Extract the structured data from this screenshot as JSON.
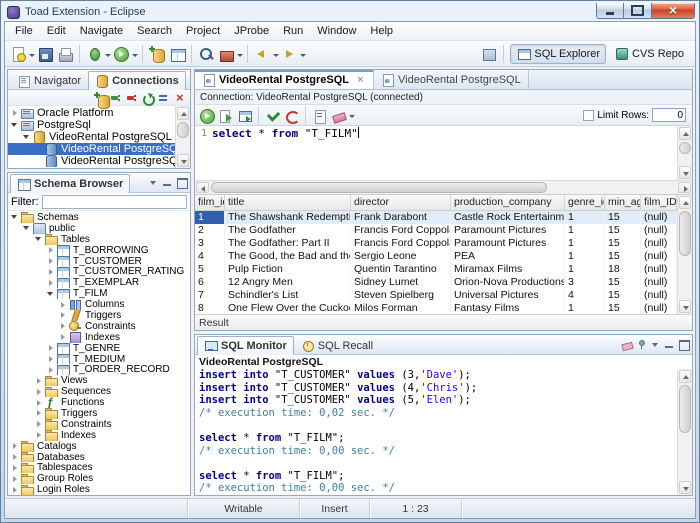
{
  "titlebar": {
    "title": "Toad Extension - Eclipse"
  },
  "menubar": {
    "items": [
      "File",
      "Edit",
      "Navigate",
      "Search",
      "Project",
      "JProbe",
      "Run",
      "Window",
      "Help"
    ]
  },
  "toolbar": {
    "items": [
      {
        "icon": "new-wizard",
        "caret": true
      },
      {
        "icon": "save"
      },
      {
        "icon": "print"
      },
      {
        "sep": true
      },
      {
        "icon": "debug",
        "caret": true
      },
      {
        "icon": "run",
        "caret": true
      },
      {
        "sep": true
      },
      {
        "icon": "new-connection"
      },
      {
        "icon": "sql-editor"
      },
      {
        "sep": true
      },
      {
        "icon": "search"
      },
      {
        "icon": "external-tools",
        "caret": true
      },
      {
        "sep": true
      },
      {
        "icon": "back",
        "caret": true
      },
      {
        "icon": "forward",
        "caret": true
      }
    ],
    "perspectives": [
      {
        "label": "SQL Explorer",
        "icon": "sql-explorer",
        "active": true
      },
      {
        "label": "CVS Repo",
        "icon": "cvs-repo",
        "active": false
      }
    ]
  },
  "connections_panel": {
    "tabs": [
      {
        "label": "Navigator",
        "icon": "navigator",
        "active": false
      },
      {
        "label": "Connections",
        "icon": "connections",
        "active": true
      }
    ],
    "corner": [
      {
        "icon": "view-menu"
      },
      {
        "icon": "minimize"
      },
      {
        "icon": "maximize"
      }
    ],
    "toolbar": [
      {
        "icon": "new-connection"
      },
      {
        "icon": "connect"
      },
      {
        "icon": "disconnect"
      },
      {
        "icon": "refresh"
      },
      {
        "icon": "collapse-all"
      },
      {
        "icon": "delete"
      }
    ],
    "tree": [
      {
        "label": "Oracle Platform",
        "level": 0,
        "expander": "collapsed",
        "icon": "platform"
      },
      {
        "label": "PostgreSql",
        "level": 0,
        "expander": "expanded",
        "icon": "platform"
      },
      {
        "label": "VideoRental PostgreSQL",
        "level": 1,
        "expander": "expanded",
        "icon": "conn-group"
      },
      {
        "label": "VideoRental PostgreSQL",
        "level": 2,
        "icon": "db",
        "selected": true
      },
      {
        "label": "VideoRental PostgreSQL",
        "level": 2,
        "icon": "db"
      }
    ]
  },
  "schema_panel": {
    "tabs": [
      {
        "label": "Schema Browser",
        "icon": "schemaview",
        "active": true
      }
    ],
    "corner": [
      {
        "icon": "view-menu"
      },
      {
        "icon": "minimize"
      },
      {
        "icon": "maximize"
      }
    ],
    "filter_label": "Filter:",
    "filter_value": "",
    "tree": [
      {
        "label": "Schemas",
        "level": 0,
        "expander": "expanded",
        "icon": "folder"
      },
      {
        "label": "public",
        "level": 1,
        "expander": "expanded",
        "icon": "schema"
      },
      {
        "label": "Tables",
        "level": 2,
        "expander": "expanded",
        "icon": "folder"
      },
      {
        "label": "T_BORROWING",
        "level": 3,
        "expander": "collapsed",
        "icon": "table"
      },
      {
        "label": "T_CUSTOMER",
        "level": 3,
        "expander": "collapsed",
        "icon": "table"
      },
      {
        "label": "T_CUSTOMER_RATING",
        "level": 3,
        "expander": "collapsed",
        "icon": "table"
      },
      {
        "label": "T_EXEMPLAR",
        "level": 3,
        "expander": "collapsed",
        "icon": "table"
      },
      {
        "label": "T_FILM",
        "level": 3,
        "expander": "expanded",
        "icon": "table"
      },
      {
        "label": "Columns",
        "level": 4,
        "expander": "collapsed",
        "icon": "columns"
      },
      {
        "label": "Triggers",
        "level": 4,
        "expander": "collapsed",
        "icon": "trigger"
      },
      {
        "label": "Constraints",
        "level": 4,
        "expander": "collapsed",
        "icon": "constraint"
      },
      {
        "label": "Indexes",
        "level": 4,
        "expander": "collapsed",
        "icon": "index"
      },
      {
        "label": "T_GENRE",
        "level": 3,
        "expander": "collapsed",
        "icon": "table"
      },
      {
        "label": "T_MEDIUM",
        "level": 3,
        "expander": "collapsed",
        "icon": "table"
      },
      {
        "label": "T_ORDER_RECORD",
        "level": 3,
        "expander": "collapsed",
        "icon": "table"
      },
      {
        "label": "Views",
        "level": 2,
        "expander": "collapsed",
        "icon": "folder"
      },
      {
        "label": "Sequences",
        "level": 2,
        "expander": "collapsed",
        "icon": "folder"
      },
      {
        "label": "Functions",
        "level": 2,
        "expander": "collapsed",
        "icon": "func"
      },
      {
        "label": "Triggers",
        "level": 2,
        "expander": "collapsed",
        "icon": "folder"
      },
      {
        "label": "Constraints",
        "level": 2,
        "expander": "collapsed",
        "icon": "folder"
      },
      {
        "label": "Indexes",
        "level": 2,
        "expander": "collapsed",
        "icon": "folder"
      },
      {
        "label": "Catalogs",
        "level": 0,
        "expander": "collapsed",
        "icon": "folder"
      },
      {
        "label": "Databases",
        "level": 0,
        "expander": "collapsed",
        "icon": "folder"
      },
      {
        "label": "Tablespaces",
        "level": 0,
        "expander": "collapsed",
        "icon": "folder"
      },
      {
        "label": "Group Roles",
        "level": 0,
        "expander": "collapsed",
        "icon": "folder"
      },
      {
        "label": "Login Roles",
        "level": 0,
        "expander": "collapsed",
        "icon": "folder"
      }
    ]
  },
  "editor": {
    "tabs": [
      {
        "label": "VideoRental PostgreSQL",
        "active": true
      },
      {
        "label": "VideoRental PostgreSQL",
        "active": false
      }
    ],
    "connection_label": "Connection: VideoRental PostgreSQL (connected)",
    "toolbar": [
      {
        "icon": "execute"
      },
      {
        "icon": "execute-script"
      },
      {
        "icon": "export"
      },
      {
        "sep": true
      },
      {
        "icon": "commit"
      },
      {
        "icon": "rollback"
      },
      {
        "sep": true
      },
      {
        "icon": "describe"
      },
      {
        "icon": "clear",
        "caret": true
      }
    ],
    "limit_rows_label": "Limit Rows:",
    "limit_rows_value": "0",
    "sql": {
      "line_number": "1",
      "segments": [
        [
          "kw",
          "select"
        ],
        [
          "pl",
          " * "
        ],
        [
          "kw",
          "from"
        ],
        [
          "pl",
          " \"T_FILM\""
        ]
      ]
    }
  },
  "results": {
    "columns": [
      "film_id",
      "title",
      "director",
      "production_company",
      "genre_id",
      "min_age",
      "film_ID_episodes"
    ],
    "rows": [
      [
        "1",
        "The Shawshank Redemption",
        "Frank Darabont",
        "Castle Rock Entertainment",
        "1",
        "15",
        "(null)"
      ],
      [
        "2",
        "The Godfather",
        "Francis Ford Coppola",
        "Paramount Pictures",
        "1",
        "15",
        "(null)"
      ],
      [
        "3",
        "The Godfather: Part II",
        "Francis Ford Coppola",
        "Paramount Pictures",
        "1",
        "15",
        "(null)"
      ],
      [
        "4",
        "The Good, the Bad and the Ugly",
        "Sergio Leone",
        "PEA",
        "1",
        "15",
        "(null)"
      ],
      [
        "5",
        "Pulp Fiction",
        "Quentin Tarantino",
        "Miramax Films",
        "1",
        "18",
        "(null)"
      ],
      [
        "6",
        "12 Angry Men",
        "Sidney Lumet",
        "Orion-Nova Productions",
        "3",
        "15",
        "(null)"
      ],
      [
        "7",
        "Schindler's List",
        "Steven Spielberg",
        "Universal Pictures",
        "4",
        "15",
        "(null)"
      ],
      [
        "8",
        "One Flew Over the Cuckoo's Nest",
        "Milos Forman",
        "Fantasy Films",
        "1",
        "15",
        "(null)"
      ]
    ],
    "status_label": "Result"
  },
  "monitor": {
    "tabs": [
      {
        "label": "SQL Monitor",
        "icon": "monitor",
        "active": true
      },
      {
        "label": "SQL Recall",
        "icon": "recall",
        "active": false
      }
    ],
    "corner": [
      {
        "icon": "clear"
      },
      {
        "icon": "pin"
      },
      {
        "icon": "view-menu"
      },
      {
        "icon": "minimize"
      },
      {
        "icon": "maximize"
      }
    ],
    "connection_label": "VideoRental PostgreSQL",
    "lines": [
      [
        [
          "kw",
          "insert into"
        ],
        [
          "pl",
          " "
        ],
        [
          "id",
          "\"T_CUSTOMER\""
        ],
        [
          "pl",
          " "
        ],
        [
          "kw",
          "values"
        ],
        [
          "pl",
          " (3,"
        ],
        [
          "str",
          "'Dave'"
        ],
        [
          "pl",
          ");"
        ]
      ],
      [
        [
          "kw",
          "insert into"
        ],
        [
          "pl",
          " "
        ],
        [
          "id",
          "\"T_CUSTOMER\""
        ],
        [
          "pl",
          " "
        ],
        [
          "kw",
          "values"
        ],
        [
          "pl",
          " (4,"
        ],
        [
          "str",
          "'Chris'"
        ],
        [
          "pl",
          ");"
        ]
      ],
      [
        [
          "kw",
          "insert into"
        ],
        [
          "pl",
          " "
        ],
        [
          "id",
          "\"T_CUSTOMER\""
        ],
        [
          "pl",
          " "
        ],
        [
          "kw",
          "values"
        ],
        [
          "pl",
          " (5,"
        ],
        [
          "str",
          "'Elen'"
        ],
        [
          "pl",
          ");"
        ]
      ],
      [
        [
          "cm",
          "/* execution time: 0,02 sec. */"
        ]
      ],
      [],
      [
        [
          "kw",
          "select"
        ],
        [
          "pl",
          " * "
        ],
        [
          "kw",
          "from"
        ],
        [
          "pl",
          " "
        ],
        [
          "id",
          "\"T_FILM\""
        ],
        [
          "pl",
          ";"
        ]
      ],
      [
        [
          "cm",
          "/* execution time: 0,00 sec. */"
        ]
      ],
      [],
      [
        [
          "kw",
          "select"
        ],
        [
          "pl",
          " * "
        ],
        [
          "kw",
          "from"
        ],
        [
          "pl",
          " "
        ],
        [
          "id",
          "\"T_FILM\""
        ],
        [
          "pl",
          ";"
        ]
      ],
      [
        [
          "cm",
          "/* execution time: 0,00 sec. */"
        ]
      ]
    ]
  },
  "statusbar": {
    "writable": "Writable",
    "insert_mode": "Insert",
    "position": "1 : 23"
  }
}
